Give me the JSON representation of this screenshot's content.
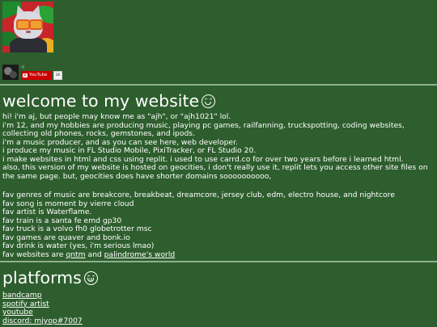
{
  "profile": {
    "avatar_icon": "cat-with-sunglasses-avatar"
  },
  "youtube_widget": {
    "channel_name": "aj",
    "button_label": "YouTube",
    "subscriber_count": "3K"
  },
  "welcome": {
    "heading": "welcome to my website",
    "heading_emoji": "smiling-face-icon",
    "intro_lines": [
      "hi! i'm aj, but people may know me as \"ajh\", or \"ajh1021\" lol.",
      "i'm 12, and my hobbies are producing music, playing pc games, railfanning, truckspotting, coding websites, collecting old phones, rocks, gemstones, and ipods.",
      "i'm a music producer, and as you can see here, web developer.",
      "i produce my music in FL Studio Mobile, PixiTracker, or FL Studio 20.",
      "i make websites in html and css using replit. i used to use carrd.co for over two years before i learned html.",
      "also, this version of my website is hosted on geocities, i don't really use it, replit lets you access other site files on the same page. but, geocities does have shorter domains soooooooooo,"
    ],
    "favs": [
      "fav genres of music are breakcore, breakbeat, dreamcore, jersey club, edm, electro house, and nightcore",
      "fav song is moment by vierre cloud",
      "fav artist is Waterflame.",
      "fav train is a santa fe emd gp30",
      "fav truck is a volvo fh0 globetrotter msc",
      "fav games are quaver and bonk.io",
      "fav drink is water (yes, i'm serious lmao)"
    ],
    "fav_websites": {
      "prefix": "fav websites are",
      "link1": "qntm",
      "joiner": "and",
      "link2": "palindrome's world"
    }
  },
  "platforms": {
    "heading": "platforms",
    "heading_emoji": "grinning-face-icon",
    "links": [
      "bandcamp",
      "spotify artist",
      "youtube",
      "discord: mjyop#7007"
    ]
  },
  "colors": {
    "background": "#2e5e2e",
    "text": "#ffffff",
    "divider": "#8fb08f",
    "youtube_red": "#cc0000"
  }
}
